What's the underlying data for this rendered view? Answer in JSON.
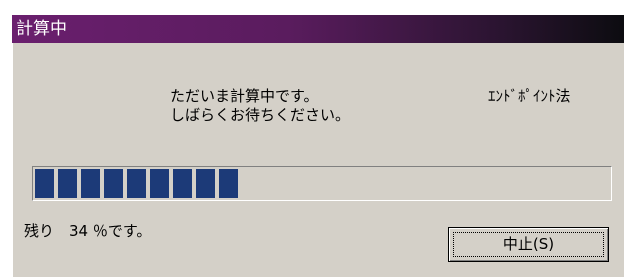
{
  "window": {
    "title": "計算中"
  },
  "message": {
    "line1": "ただいま計算中です。",
    "line2": "しばらくお待ちください。"
  },
  "method_label": "ｴﾝﾄﾞﾎﾟｲﾝﾄ法",
  "progress": {
    "percent": 34,
    "fill_color": "#1c3a78"
  },
  "status": {
    "remaining_text": "残り　34 ％です。"
  },
  "buttons": {
    "cancel_label": "中止(S)"
  }
}
